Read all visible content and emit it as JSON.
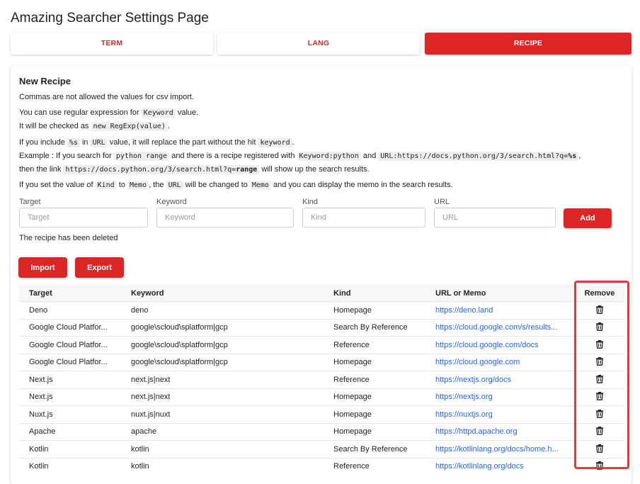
{
  "page": {
    "title": "Amazing Searcher Settings Page"
  },
  "tabs": [
    {
      "label": "TERM",
      "active": false
    },
    {
      "label": "LANG",
      "active": false
    },
    {
      "label": "RECIPE",
      "active": true
    }
  ],
  "recipe": {
    "section_title": "New Recipe",
    "p1": "Commas are not allowed the values for csv import.",
    "p2a": "You can use regular expression for ",
    "p2_code": "Keyword",
    "p2b": " value.",
    "p3a": "It will be checked as ",
    "p3_code": "new RegExp(value)",
    "p3b": ".",
    "p4a": "If you include ",
    "p4_code1": "%s",
    "p4b": " in ",
    "p4_code2": "URL",
    "p4c": " value, it will replace the part without the hit ",
    "p4_code3": "keyword",
    "p4d": ".",
    "p5a": "Example : If you search for ",
    "p5_code1": "python range",
    "p5b": " and there is a recipe registered with ",
    "p5_code2": "Keyword:python",
    "p5c": " and ",
    "p5_code3a": "URL:https://docs.python.org/3/search.html?q=",
    "p5_code3b": "%s",
    "p5d": ",",
    "p6a": "then the link ",
    "p6_code_a": "https://docs.python.org/3/search.html?q=",
    "p6_code_b": "range",
    "p6b": " will show up the search results.",
    "p7a": "If you set the value of ",
    "p7_code1": "Kind",
    "p7b": " to ",
    "p7_code2": "Memo",
    "p7c": ", the ",
    "p7_code3": "URL",
    "p7d": " will be changed to ",
    "p7_code4": "Memo",
    "p7e": " and you can display the memo in the search results."
  },
  "form": {
    "target_label": "Target",
    "target_placeholder": "Target",
    "keyword_label": "Keyword",
    "keyword_placeholder": "Keyword",
    "kind_label": "Kind",
    "kind_placeholder": "Kind",
    "url_label": "URL",
    "url_placeholder": "URL",
    "add_label": "Add"
  },
  "status": "The recipe has been deleted",
  "actions": {
    "import_label": "Import",
    "export_label": "Export"
  },
  "table": {
    "headers": {
      "target": "Target",
      "keyword": "Keyword",
      "kind": "Kind",
      "url": "URL or Memo",
      "remove": "Remove"
    },
    "rows": [
      {
        "target": "Deno",
        "keyword": "deno",
        "kind": "Homepage",
        "url": "https://deno.land"
      },
      {
        "target": "Google Cloud Platfor...",
        "keyword": "google\\scloud\\splatform|gcp",
        "kind": "Search By Reference",
        "url": "https://cloud.google.com/s/results..."
      },
      {
        "target": "Google Cloud Platfor...",
        "keyword": "google\\scloud\\splatform|gcp",
        "kind": "Reference",
        "url": "https://cloud.google.com/docs"
      },
      {
        "target": "Google Cloud Platfor...",
        "keyword": "google\\scloud\\splatform|gcp",
        "kind": "Homepage",
        "url": "https://cloud.google.com"
      },
      {
        "target": "Next.js",
        "keyword": "next.js|next",
        "kind": "Reference",
        "url": "https://nextjs.org/docs"
      },
      {
        "target": "Next.js",
        "keyword": "next.js|next",
        "kind": "Homepage",
        "url": "https://nextjs.org"
      },
      {
        "target": "Nuxt.js",
        "keyword": "nuxt.js|nuxt",
        "kind": "Homepage",
        "url": "https://nuxtjs.org"
      },
      {
        "target": "Apache",
        "keyword": "apache",
        "kind": "Homepage",
        "url": "https://httpd.apache.org"
      },
      {
        "target": "Kotlin",
        "keyword": "kotlin",
        "kind": "Search By Reference",
        "url": "https://kotlinlang.org/docs/home.h..."
      },
      {
        "target": "Kotlin",
        "keyword": "kotlin",
        "kind": "Reference",
        "url": "https://kotlinlang.org/docs"
      }
    ]
  },
  "colors": {
    "accent": "#dc2626",
    "link": "#2563eb",
    "highlight": "#e4393f"
  },
  "icons": {
    "remove": "trash-icon"
  }
}
